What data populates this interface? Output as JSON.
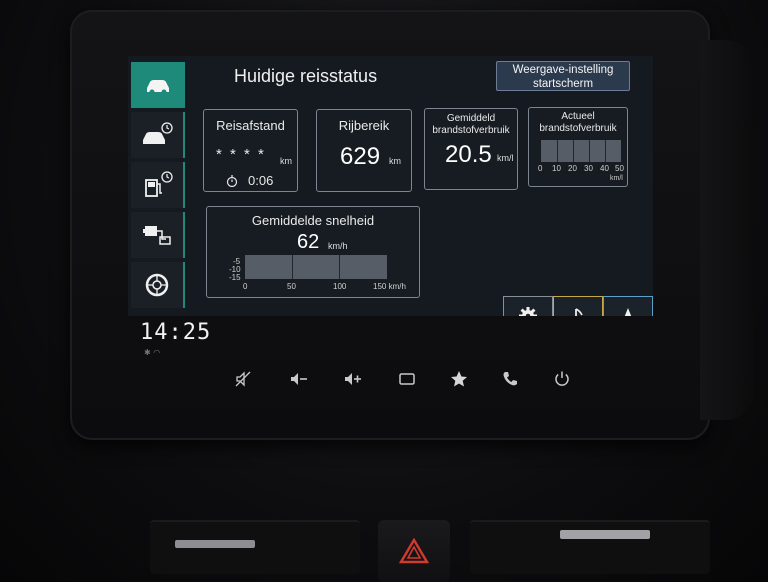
{
  "header": {
    "title": "Huidige reisstatus",
    "settings_button_line1": "Weergave-instelling",
    "settings_button_line2": "startscherm"
  },
  "tabs": [
    {
      "name": "current-trip",
      "icon": "car-icon",
      "active": true
    },
    {
      "name": "trip-history",
      "icon": "car-clock-icon",
      "active": false
    },
    {
      "name": "fuel-history",
      "icon": "fuel-clock-icon",
      "active": false
    },
    {
      "name": "energy-flow",
      "icon": "engine-flow-icon",
      "active": false
    },
    {
      "name": "tires",
      "icon": "tire-icon",
      "active": false
    }
  ],
  "cards": {
    "distance": {
      "label": "Reisafstand",
      "value": "* * * *",
      "unit": "km",
      "time": "0:06"
    },
    "range": {
      "label": "Rijbereik",
      "value": "629",
      "unit": "km"
    },
    "avg_fuel": {
      "label_line1": "Gemiddeld",
      "label_line2": "brandstofverbruik",
      "value": "20.5",
      "unit": "km/l"
    },
    "cur_fuel": {
      "label_line1": "Actueel",
      "label_line2": "brandstofverbruik",
      "scale": [
        "0",
        "10",
        "20",
        "30",
        "40",
        "50"
      ],
      "unit": "km/l",
      "level": 0
    },
    "avg_speed": {
      "label": "Gemiddelde snelheid",
      "value": "62",
      "unit": "km/h",
      "y_scale": [
        "-5",
        "-10",
        "-15"
      ],
      "x_scale": [
        "0",
        "50",
        "100",
        "150 km/h"
      ]
    }
  },
  "bottom_buttons": [
    {
      "name": "settings",
      "icon": "gear-icon"
    },
    {
      "name": "media",
      "icon": "music-note-icon"
    },
    {
      "name": "navigation",
      "icon": "navigation-arrow-icon"
    }
  ],
  "status": {
    "clock": "14:25"
  },
  "hardware_buttons": [
    {
      "name": "mute",
      "icon": "mute-icon"
    },
    {
      "name": "volume-down",
      "icon": "volume-down-icon"
    },
    {
      "name": "volume-up",
      "icon": "volume-up-icon"
    },
    {
      "name": "home",
      "icon": "home-rect-icon"
    },
    {
      "name": "favorite",
      "icon": "star-icon"
    },
    {
      "name": "phone",
      "icon": "phone-icon"
    },
    {
      "name": "power",
      "icon": "power-icon"
    }
  ],
  "colors": {
    "accent": "#1e8a7a",
    "settings_button": "#2c3a4e",
    "media_border": "#c8a74a",
    "nav_border": "#5aa0c8",
    "hazard": "#d23a2e"
  }
}
